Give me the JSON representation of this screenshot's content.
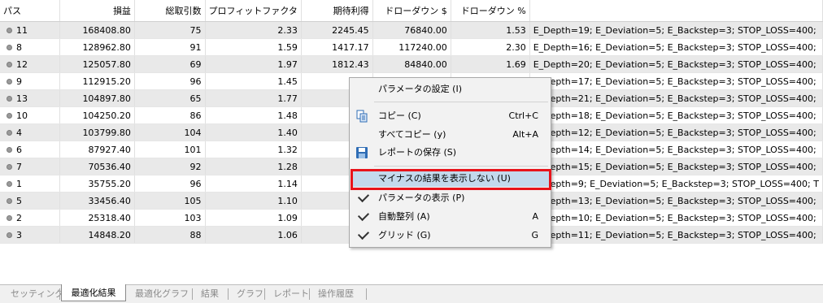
{
  "table": {
    "columns": [
      "パス",
      "損益",
      "総取引数",
      "プロフィットファクタ",
      "期待利得",
      "ドローダウン $",
      "ドローダウン %",
      ""
    ],
    "rows": [
      {
        "pass": "11",
        "profit": "168408.80",
        "trades": "75",
        "pf": "2.33",
        "expected": "2245.45",
        "dd_usd": "76840.00",
        "dd_pct": "1.53",
        "inputs": "E_Depth=19; E_Deviation=5; E_Backstep=3; STOP_LOSS=400;"
      },
      {
        "pass": "8",
        "profit": "128962.80",
        "trades": "91",
        "pf": "1.59",
        "expected": "1417.17",
        "dd_usd": "117240.00",
        "dd_pct": "2.30",
        "inputs": "E_Depth=16; E_Deviation=5; E_Backstep=3; STOP_LOSS=400;"
      },
      {
        "pass": "12",
        "profit": "125057.80",
        "trades": "69",
        "pf": "1.97",
        "expected": "1812.43",
        "dd_usd": "84840.00",
        "dd_pct": "1.69",
        "inputs": "E_Depth=20; E_Deviation=5; E_Backstep=3; STOP_LOSS=400;"
      },
      {
        "pass": "9",
        "profit": "112915.20",
        "trades": "96",
        "pf": "1.45",
        "expected": "",
        "dd_usd": "",
        "dd_pct": "",
        "inputs": "E_Depth=17; E_Deviation=5; E_Backstep=3; STOP_LOSS=400;"
      },
      {
        "pass": "13",
        "profit": "104897.80",
        "trades": "65",
        "pf": "1.77",
        "expected": "",
        "dd_usd": "",
        "dd_pct": "",
        "inputs": "E_Depth=21; E_Deviation=5; E_Backstep=3; STOP_LOSS=400;"
      },
      {
        "pass": "10",
        "profit": "104250.20",
        "trades": "86",
        "pf": "1.48",
        "expected": "",
        "dd_usd": "",
        "dd_pct": "",
        "inputs": "E_Depth=18; E_Deviation=5; E_Backstep=3; STOP_LOSS=400;"
      },
      {
        "pass": "4",
        "profit": "103799.80",
        "trades": "104",
        "pf": "1.40",
        "expected": "",
        "dd_usd": "",
        "dd_pct": "",
        "inputs": "E_Depth=12; E_Deviation=5; E_Backstep=3; STOP_LOSS=400;"
      },
      {
        "pass": "6",
        "profit": "87927.40",
        "trades": "101",
        "pf": "1.32",
        "expected": "",
        "dd_usd": "",
        "dd_pct": "",
        "inputs": "E_Depth=14; E_Deviation=5; E_Backstep=3; STOP_LOSS=400;"
      },
      {
        "pass": "7",
        "profit": "70536.40",
        "trades": "92",
        "pf": "1.28",
        "expected": "",
        "dd_usd": "",
        "dd_pct": "",
        "inputs": "E_Depth=15; E_Deviation=5; E_Backstep=3; STOP_LOSS=400;"
      },
      {
        "pass": "1",
        "profit": "35755.20",
        "trades": "96",
        "pf": "1.14",
        "expected": "",
        "dd_usd": "",
        "dd_pct": "",
        "inputs": "E_Depth=9; E_Deviation=5; E_Backstep=3; STOP_LOSS=400; T"
      },
      {
        "pass": "5",
        "profit": "33456.40",
        "trades": "105",
        "pf": "1.10",
        "expected": "",
        "dd_usd": "",
        "dd_pct": "",
        "inputs": "E_Depth=13; E_Deviation=5; E_Backstep=3; STOP_LOSS=400;"
      },
      {
        "pass": "2",
        "profit": "25318.40",
        "trades": "103",
        "pf": "1.09",
        "expected": "",
        "dd_usd": "",
        "dd_pct": "",
        "inputs": "E_Depth=10; E_Deviation=5; E_Backstep=3; STOP_LOSS=400;"
      },
      {
        "pass": "3",
        "profit": "14848.20",
        "trades": "88",
        "pf": "1.06",
        "expected": "",
        "dd_usd": "",
        "dd_pct": "",
        "inputs": "E_Depth=11; E_Deviation=5; E_Backstep=3; STOP_LOSS=400;"
      }
    ]
  },
  "context_menu": {
    "items": [
      {
        "label": "パラメータの設定 (I)",
        "shortcut": "",
        "icon": "",
        "checked": false,
        "highlighted": false
      },
      {
        "label": "コピー (C)",
        "shortcut": "Ctrl+C",
        "icon": "copy-icon",
        "checked": false,
        "highlighted": false
      },
      {
        "label": "すべてコピー (y)",
        "shortcut": "Alt+A",
        "icon": "",
        "checked": false,
        "highlighted": false
      },
      {
        "label": "レポートの保存 (S)",
        "shortcut": "",
        "icon": "save-icon",
        "checked": false,
        "highlighted": false
      },
      {
        "label": "マイナスの結果を表示しない (U)",
        "shortcut": "",
        "icon": "",
        "checked": false,
        "highlighted": true
      },
      {
        "label": "パラメータの表示 (P)",
        "shortcut": "",
        "icon": "check-icon",
        "checked": true,
        "highlighted": false
      },
      {
        "label": "自動整列 (A)",
        "shortcut": "A",
        "icon": "check-icon",
        "checked": true,
        "highlighted": false
      },
      {
        "label": "グリッド (G)",
        "shortcut": "G",
        "icon": "check-icon",
        "checked": true,
        "highlighted": false
      }
    ],
    "highlight_color": "#c3d9ec",
    "annotation_color": "#e8141b"
  },
  "tabs": {
    "items": [
      "セッティング",
      "最適化結果",
      "最適化グラフ",
      "結果",
      "グラフ",
      "レポート",
      "操作履歴"
    ],
    "active": "最適化結果"
  }
}
